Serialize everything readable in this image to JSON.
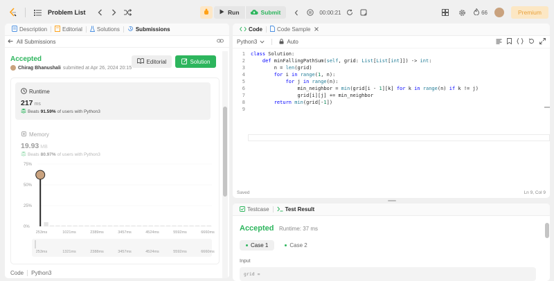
{
  "topbar": {
    "title": "Problem List",
    "run_label": "Run",
    "submit_label": "Submit",
    "timer": "00:00:21",
    "streak": "66",
    "premium_label": "Premium"
  },
  "left": {
    "tabs": [
      {
        "label": "Description"
      },
      {
        "label": "Editorial"
      },
      {
        "label": "Solutions"
      },
      {
        "label": "Submissions"
      }
    ],
    "back_label": "All Submissions",
    "status": "Accepted",
    "user": "Chirag Bhanushali",
    "submitted_text": "submitted at Apr 26, 2024 20:15",
    "editorial_btn": "Editorial",
    "solution_btn": "Solution",
    "runtime": {
      "label": "Runtime",
      "value": "217",
      "unit": "ms",
      "beats_prefix": "Beats",
      "beats": "91.59%",
      "beats_suffix": "of users with Python3"
    },
    "memory": {
      "label": "Memory",
      "value": "19.93",
      "unit": "MB",
      "beats_prefix": "Beats",
      "beats": "80.97%",
      "beats_suffix": "of users with Python3"
    },
    "footer_code": "Code",
    "footer_lang": "Python3"
  },
  "chart_data": {
    "type": "bar",
    "y_ticks": [
      "75%",
      "50%",
      "25%",
      "0%"
    ],
    "x_ticks": [
      "253ms",
      "1021ms",
      "2389ms",
      "3457ms",
      "4524ms",
      "5592ms",
      "6660ms"
    ],
    "range_ticks": [
      "253ms",
      "1321ms",
      "2388ms",
      "3457ms",
      "4524ms",
      "5592ms",
      "6660ms"
    ],
    "ylim": [
      0,
      75
    ],
    "values": [
      62,
      5,
      1,
      1,
      1,
      1,
      1,
      1,
      1,
      1,
      1,
      1,
      1,
      1,
      1,
      1,
      1,
      1,
      1,
      1,
      1,
      1,
      1,
      1,
      1,
      1,
      1,
      1,
      1,
      1
    ],
    "highlight_index": 0
  },
  "code": {
    "tabs": [
      {
        "label": "Code"
      },
      {
        "label": "Code Sample"
      }
    ],
    "language": "Python3",
    "autosave": "Auto",
    "status": "Saved",
    "cursor": "Ln 9, Col 9",
    "lines": [
      "class Solution:",
      "    def minFallingPathSum(self, grid: List[List[int]]) -> int:",
      "        n = len(grid)",
      "        for i in range(1, n):",
      "            for j in range(n):",
      "                min_neighbor = min(grid[i - 1][k] for k in range(n) if k != j)",
      "                grid[i][j] += min_neighbor",
      "        return min(grid[-1])",
      ""
    ]
  },
  "result": {
    "tabs": [
      {
        "label": "Testcase"
      },
      {
        "label": "Test Result"
      }
    ],
    "status": "Accepted",
    "runtime": "Runtime: 37 ms",
    "cases": [
      "Case 1",
      "Case 2"
    ],
    "input_label": "Input",
    "input_value": "grid ="
  },
  "colors": {
    "accent_green": "#2db55d",
    "premium_bg": "#fce7c4",
    "premium_text": "#e8a13b"
  }
}
